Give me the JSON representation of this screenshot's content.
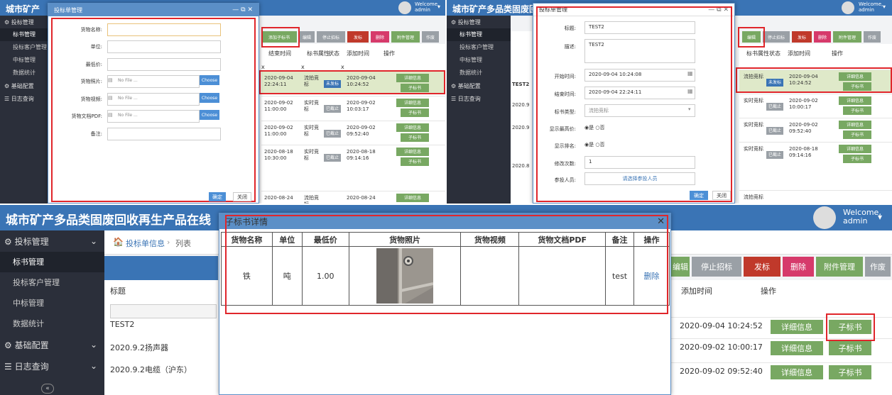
{
  "app_title": "城市矿产多品类固废回收再生产品在线",
  "app_title_short": "城市矿产",
  "user": {
    "welcome": "Welcome,",
    "name": "admin"
  },
  "sidebar": {
    "group1": "投标管理",
    "items": [
      "标书管理",
      "投标客户管理",
      "中标管理",
      "数据统计"
    ],
    "group2": "基础配置",
    "group3": "日志查询"
  },
  "breadcrumb": {
    "home": "投标单信息",
    "current": "列表"
  },
  "toolbar": {
    "add": "添加子标书",
    "edit": "编辑",
    "stop": "停止招标",
    "publish": "发标",
    "delete": "删除",
    "attach": "附件管理",
    "draft": "作废"
  },
  "table_headers": {
    "title": "标题",
    "end_time": "结束时间",
    "attr": "标书属性",
    "status": "状态",
    "add_time": "添加时间",
    "op": "操作",
    "x": "x"
  },
  "status_labels": {
    "pending": "未发标",
    "done": "已截止"
  },
  "row_buttons": {
    "detail": "详细信息",
    "child": "子标书"
  },
  "type_labels": {
    "flow": "流拍竞标",
    "realtime": "实时竞标"
  },
  "panel1": {
    "dialog_title": "投标单管理",
    "fields": [
      "货物名称:",
      "单位:",
      "最低价:",
      "货物照片:",
      "货物视频:",
      "货物文档PDF:",
      "备注:"
    ],
    "file_placeholder": "No File ...",
    "choose": "Choose",
    "ok": "确定",
    "close": "关闭",
    "rows": [
      {
        "end": "2020-09-04 22:24:11",
        "attr": "流拍竞标",
        "status": "未发标",
        "add": "2020-09-04 10:24:52"
      },
      {
        "end": "2020-09-02 11:00:00",
        "attr": "实时竞标",
        "status": "已截止",
        "add": "2020-09-02 10:03:17"
      },
      {
        "end": "2020-09-02 11:00:00",
        "attr": "实时竞标",
        "status": "已截止",
        "add": "2020-09-02 09:52:40"
      },
      {
        "end": "2020-08-18 10:30:00",
        "attr": "实时竞标",
        "status": "已截止",
        "add": "2020-08-18 09:14:16"
      },
      {
        "end": "2020-08-24",
        "attr": "流拍竞标",
        "status": "",
        "add": "2020-08-24"
      }
    ]
  },
  "panel2": {
    "dialog_title": "投标单管理",
    "fields": {
      "title_lbl": "标题:",
      "title_val": "TEST2",
      "desc_lbl": "描述:",
      "desc_val": "TEST2",
      "start_lbl": "开始时间:",
      "start_val": "2020-09-04 10:24:08",
      "end_lbl": "结束时间:",
      "end_val": "2020-09-04 22:24:11",
      "type_lbl": "标书类型:",
      "type_val": "流拍竞标",
      "showmin_lbl": "显示最高价:",
      "yes": "是",
      "no": "否",
      "showrank_lbl": "显示排名:",
      "edits_lbl": "修改次数:",
      "edits_val": "1",
      "people_lbl": "参投人员:",
      "people_btn": "请选择参投人员"
    },
    "ok": "确定",
    "close": "关闭",
    "side_rows": [
      "TEST2",
      "2020.9",
      "2020.9",
      "2020.8"
    ],
    "rows": [
      {
        "attr": "流拍竞标",
        "status": "未发标",
        "add": "2020-09-04 10:24:52"
      },
      {
        "attr": "实时竞标",
        "status": "已截止",
        "add": "2020-09-02 10:00:17"
      },
      {
        "attr": "实时竞标",
        "status": "已截止",
        "add": "2020-09-02 09:52:40"
      },
      {
        "attr": "实时竞标",
        "status": "已截止",
        "add": "2020-08-18 09:14:16"
      },
      {
        "attr": "流拍竞标",
        "status": "",
        "add": ""
      }
    ]
  },
  "panel3": {
    "dialog_title": "子标书详情",
    "headers": [
      "货物名称",
      "单位",
      "最低价",
      "货物照片",
      "货物视频",
      "货物文档PDF",
      "备注",
      "操作"
    ],
    "row": {
      "name": "铁",
      "unit": "吨",
      "price": "1.00",
      "note": "test",
      "op": "删除"
    },
    "list_titles": [
      "TEST2",
      "2020.9.2扬声器",
      "2020.9.2电缆（沪东）"
    ],
    "list_times": [
      "2020-09-04 10:24:52",
      "2020-09-02 10:00:17",
      "2020-09-02 09:52:40"
    ],
    "add_time_hdr": "添加时间",
    "op_hdr": "操作"
  }
}
